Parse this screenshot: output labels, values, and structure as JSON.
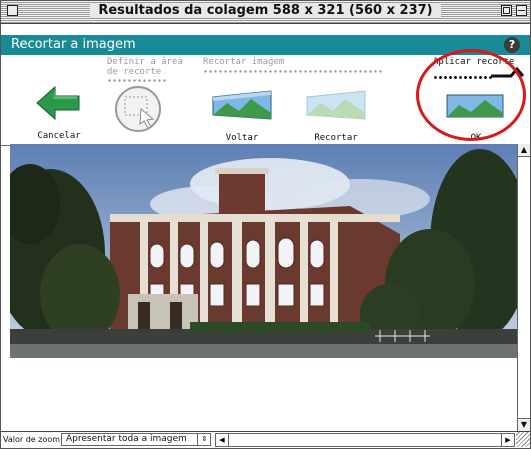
{
  "window": {
    "title": "Resultados da colagem 588 x 321 (560 x 237)"
  },
  "header": {
    "title": "Recortar a imagem",
    "help_icon": "?"
  },
  "steps": [
    {
      "label_line1": "Definir a área",
      "label_line2": "de recorte",
      "state": "inactive"
    },
    {
      "label_line1": "Recortar imagem",
      "label_line2": "",
      "state": "inactive"
    },
    {
      "label_line1": "Aplicar recorte",
      "label_line2": "",
      "state": "active"
    }
  ],
  "toolbar": {
    "cancel_label": "Cancelar",
    "back_label": "Voltar",
    "crop_label": "Recortar",
    "ok_label": "OK"
  },
  "status_bar": {
    "zoom_label": "Valor de zoom:",
    "zoom_value": "Apresentar toda a imagem"
  },
  "colors": {
    "header_bg": "#1a8a96",
    "highlight_circle": "#d7191c",
    "cancel_arrow": "#2a9a4a"
  }
}
